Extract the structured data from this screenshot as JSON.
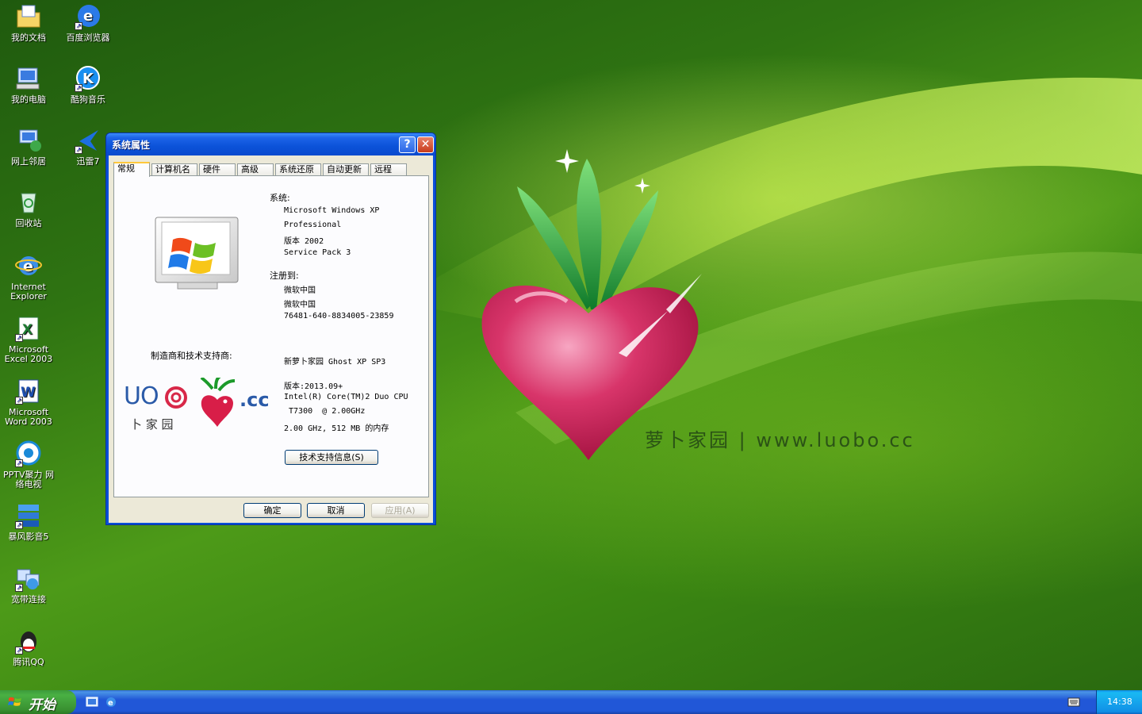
{
  "desktop": {
    "brand_text": "萝卜家园 | www.luobo.cc",
    "icons": [
      {
        "label": "我的文档",
        "icon": "folder-documents-icon"
      },
      {
        "label": "百度浏览器",
        "icon": "baidu-browser-icon"
      },
      {
        "label": "我的电脑",
        "icon": "my-computer-icon"
      },
      {
        "label": "酷狗音乐",
        "icon": "kugou-music-icon"
      },
      {
        "label": "网上邻居",
        "icon": "network-icon"
      },
      {
        "label": "迅雷7",
        "icon": "xunlei-icon"
      },
      {
        "label": "回收站",
        "icon": "recycle-bin-icon"
      },
      {
        "label": "Internet\nExplorer",
        "icon": "ie-icon"
      },
      {
        "label": "Microsoft\nExcel 2003",
        "icon": "excel-icon"
      },
      {
        "label": "Microsoft\nWord 2003",
        "icon": "word-icon"
      },
      {
        "label": "PPTV聚力 网\n络电视",
        "icon": "pptv-icon"
      },
      {
        "label": "暴风影音5",
        "icon": "baofeng-icon"
      },
      {
        "label": "宽带连接",
        "icon": "broadband-icon"
      },
      {
        "label": "腾讯QQ",
        "icon": "qq-icon"
      }
    ]
  },
  "window": {
    "title": "系统属性",
    "help_glyph": "?",
    "close_glyph": "✕",
    "tabs": [
      "常规",
      "计算机名",
      "硬件",
      "高级",
      "系统还原",
      "自动更新",
      "远程"
    ],
    "active_tab": 0,
    "system_label": "系统:",
    "system_lines": [
      "Microsoft Windows XP",
      "Professional",
      "版本 2002",
      "Service Pack 3"
    ],
    "registered_label": "注册到:",
    "registered_lines": [
      "微软中国",
      "微软中国",
      "76481-640-8834005-23859"
    ],
    "oem_label": "制造商和技术支持商:",
    "oem_name": "新萝卜家园 Ghost XP SP3",
    "oem_lines": [
      "版本:2013.09+",
      "Intel(R) Core(TM)2 Duo CPU",
      " T7300  @ 2.00GHz",
      "2.00 GHz, 512 MB 的内存"
    ],
    "oem_logo_text": {
      "main": "UO",
      "sub": "卜 家 园",
      "suffix": ".cc"
    },
    "support_button": "技术支持信息(S)",
    "ok_button": "确定",
    "cancel_button": "取消",
    "apply_button": "应用(A)"
  },
  "taskbar": {
    "start_label": "开始",
    "quick_launch": [
      "show-desktop-icon",
      "ie-icon"
    ],
    "clock": "14:38"
  },
  "colors": {
    "xp_blue": "#0a4fd8",
    "start_green": "#3a9232",
    "dialog_bg": "#ece9d8",
    "wallpaper_green": "#3f8a16",
    "radish_pink": "#d4245a"
  }
}
